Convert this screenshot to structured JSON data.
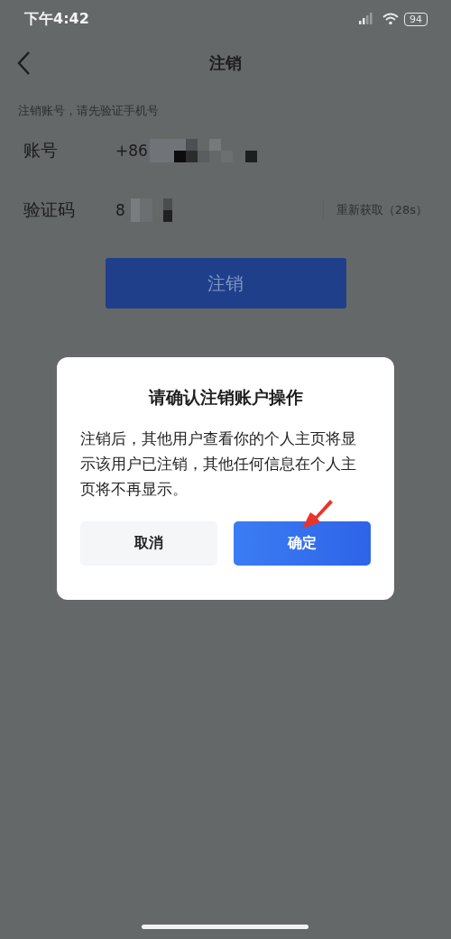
{
  "status_bar": {
    "time": "下午4:42",
    "battery": "94"
  },
  "nav": {
    "title": "注销"
  },
  "hint": "注销账号，请先验证手机号",
  "fields": [
    {
      "label": "账号",
      "value": "+86"
    },
    {
      "label": "验证码",
      "value": "8",
      "action": "重新获取（28s）"
    }
  ],
  "submit": {
    "label": "注销"
  },
  "dialog": {
    "title": "请确认注销账户操作",
    "message": "注销后，其他用户查看你的个人主页将显示该用户已注销，其他任何信息在个人主页将不再显示。",
    "buttons": [
      {
        "label": "取消",
        "kind": "secondary"
      },
      {
        "label": "确定",
        "kind": "primary"
      }
    ]
  }
}
